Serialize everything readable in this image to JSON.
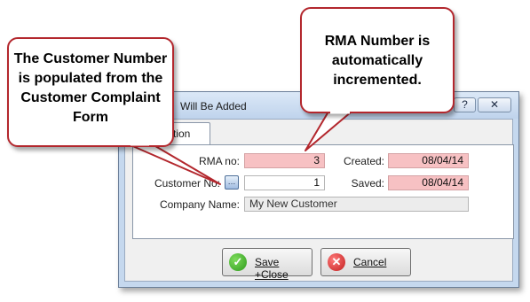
{
  "dialog": {
    "title": "Will Be Added",
    "help_button": "?",
    "close_button": "✕",
    "tab_label": "tion",
    "fields": {
      "rma_label": "RMA no:",
      "rma_value": "3",
      "customer_label": "Customer No:",
      "customer_value": "1",
      "company_label": "Company Name:",
      "company_value": "My New Customer",
      "created_label": "Created:",
      "created_value": "08/04/14",
      "saved_label": "Saved:",
      "saved_value": "08/04/14"
    },
    "buttons": {
      "save_label": "Save +Close",
      "cancel_label": "Cancel"
    },
    "icons": {
      "lookup": "ellipsis-icon",
      "save": "check-icon",
      "cancel": "x-icon"
    }
  },
  "callouts": {
    "left_text": "The Customer Number is populated from the Customer Complaint Form",
    "right_text": "RMA Number is automatically incremented."
  },
  "colors": {
    "callout_border": "#b3272d",
    "readonly_field": "#f7c1c3",
    "window_frame": "#c5d8ee"
  }
}
